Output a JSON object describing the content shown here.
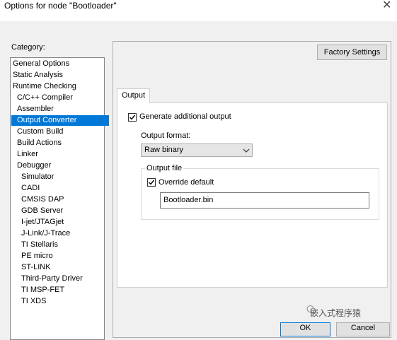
{
  "window": {
    "title": "Options for node \"Bootloader\""
  },
  "category": {
    "label": "Category:",
    "items": [
      {
        "label": "General Options",
        "indent": 0
      },
      {
        "label": "Static Analysis",
        "indent": 0
      },
      {
        "label": "Runtime Checking",
        "indent": 0
      },
      {
        "label": "C/C++ Compiler",
        "indent": 1
      },
      {
        "label": "Assembler",
        "indent": 1
      },
      {
        "label": "Output Converter",
        "indent": 1,
        "selected": true
      },
      {
        "label": "Custom Build",
        "indent": 1
      },
      {
        "label": "Build Actions",
        "indent": 1
      },
      {
        "label": "Linker",
        "indent": 1
      },
      {
        "label": "Debugger",
        "indent": 1
      },
      {
        "label": "Simulator",
        "indent": 2
      },
      {
        "label": "CADI",
        "indent": 2
      },
      {
        "label": "CMSIS DAP",
        "indent": 2
      },
      {
        "label": "GDB Server",
        "indent": 2
      },
      {
        "label": "I-jet/JTAGjet",
        "indent": 2
      },
      {
        "label": "J-Link/J-Trace",
        "indent": 2
      },
      {
        "label": "TI Stellaris",
        "indent": 2
      },
      {
        "label": "PE micro",
        "indent": 2
      },
      {
        "label": "ST-LINK",
        "indent": 2
      },
      {
        "label": "Third-Party Driver",
        "indent": 2
      },
      {
        "label": "TI MSP-FET",
        "indent": 2
      },
      {
        "label": "TI XDS",
        "indent": 2
      }
    ]
  },
  "toolbar": {
    "factory_settings_label": "Factory Settings"
  },
  "tabs": [
    {
      "label": "Output"
    }
  ],
  "output": {
    "generate_label": "Generate additional output",
    "generate_checked": true,
    "format_label": "Output format:",
    "format_value": "Raw binary",
    "file_group_label": "Output file",
    "override_label": "Override default",
    "override_checked": true,
    "filename": "Bootloader.bin"
  },
  "footer": {
    "ok_label": "OK",
    "cancel_label": "Cancel"
  },
  "watermark": {
    "text": "嵌入式程序猿"
  },
  "colors": {
    "selection": "#0078d7",
    "window_bg": "#f0f0f0"
  }
}
